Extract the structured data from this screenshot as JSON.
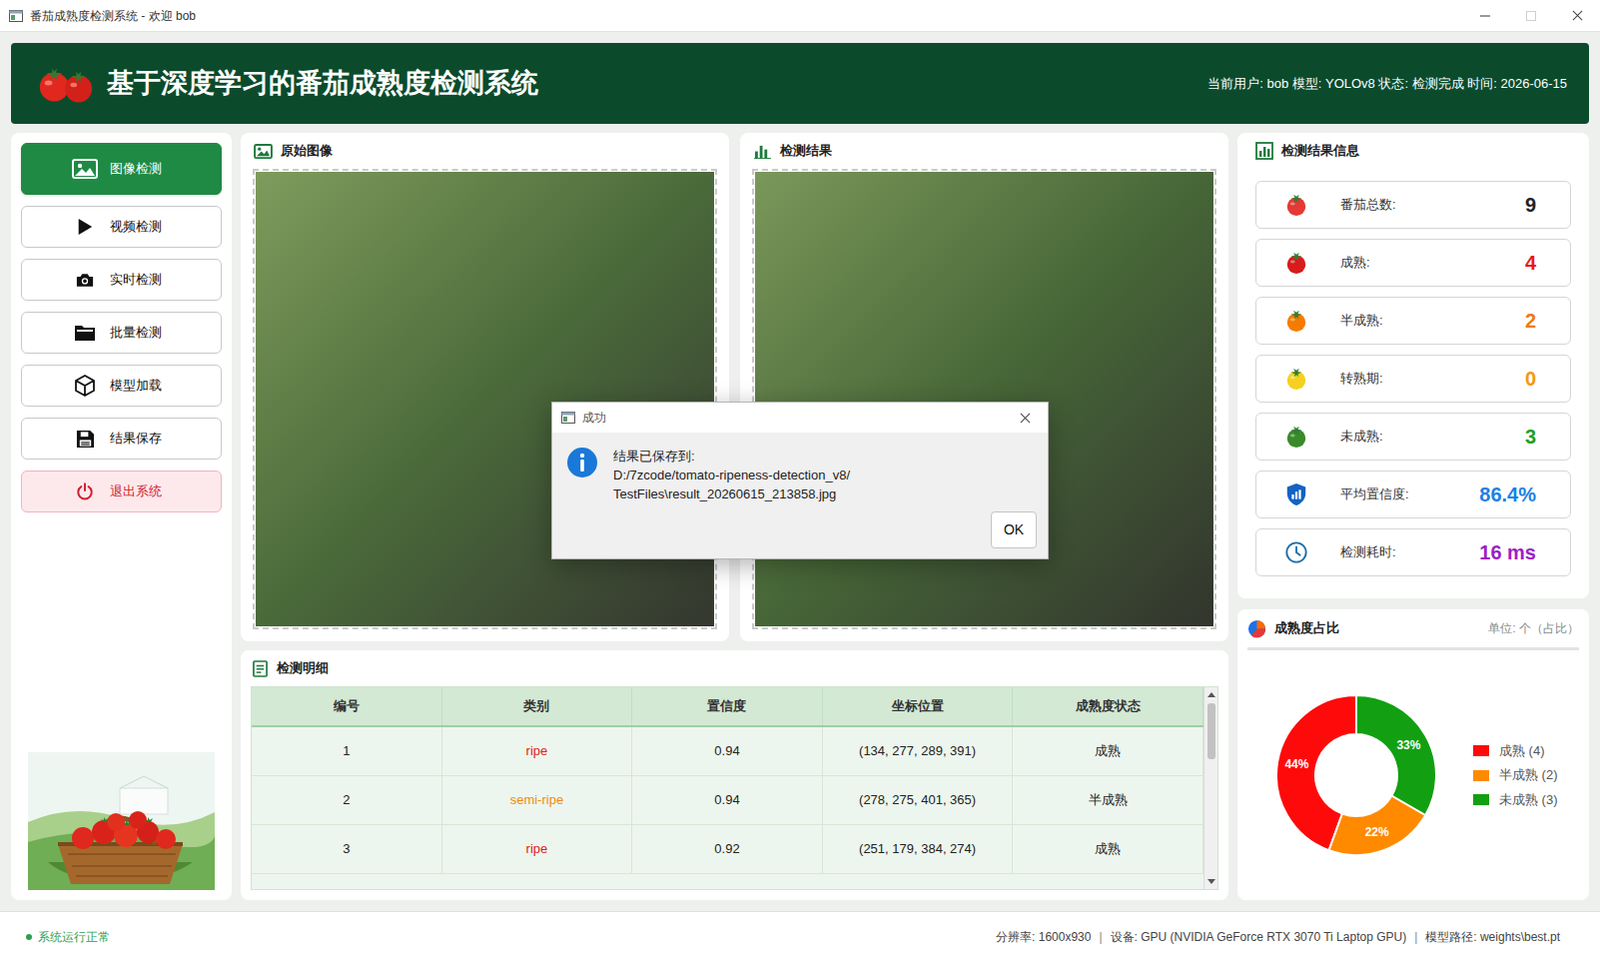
{
  "window": {
    "title": "番茄成熟度检测系统 - 欢迎 bob",
    "maximize_disabled": true
  },
  "header": {
    "title": "基于深度学习的番茄成熟度检测系统",
    "info": "当前用户: bob 模型: YOLOv8 状态: 检测完成 时间: 2026-06-15"
  },
  "sidebar": {
    "items": [
      {
        "label": "图像检测",
        "selected": true,
        "kind": "nav"
      },
      {
        "label": "视频检测",
        "selected": false,
        "kind": "nav"
      },
      {
        "label": "实时检测",
        "selected": false,
        "kind": "nav"
      },
      {
        "label": "批量检测",
        "selected": false,
        "kind": "nav"
      },
      {
        "label": "模型加载",
        "selected": false,
        "kind": "nav"
      },
      {
        "label": "结果保存",
        "selected": false,
        "kind": "nav"
      },
      {
        "label": "退出系统",
        "selected": false,
        "kind": "exit"
      }
    ]
  },
  "panels": {
    "original": "原始图像",
    "result": "检测结果"
  },
  "table": {
    "title": "检测明细",
    "columns": [
      "编号",
      "类别",
      "置信度",
      "坐标位置",
      "成熟度状态"
    ],
    "rows": [
      {
        "cells": [
          "1",
          "ripe",
          "0.94",
          "(134, 277, 289, 391)",
          "成熟"
        ],
        "color": "#e02020"
      },
      {
        "cells": [
          "2",
          "semi-ripe",
          "0.94",
          "(278, 275, 401, 365)",
          "半成熟"
        ],
        "color": "#f08a10"
      },
      {
        "cells": [
          "3",
          "ripe",
          "0.92",
          "(251, 179, 384, 274)",
          "成熟"
        ],
        "color": "#e02020"
      }
    ]
  },
  "stats": {
    "title": "检测结果信息",
    "items": [
      {
        "label": "番茄总数:",
        "value": "9",
        "color": "#222222"
      },
      {
        "label": "成熟:",
        "value": "4",
        "color": "#e81818"
      },
      {
        "label": "半成熟:",
        "value": "2",
        "color": "#f07a12"
      },
      {
        "label": "转熟期:",
        "value": "0",
        "color": "#f39a0a"
      },
      {
        "label": "未成熟:",
        "value": "3",
        "color": "#22a022"
      },
      {
        "label": "平均置信度:",
        "value": "86.4%",
        "color": "#1a80e6"
      },
      {
        "label": "检测耗时:",
        "value": "16 ms",
        "color": "#9c1fc4"
      }
    ]
  },
  "chart": {
    "title": "成熟度占比",
    "unit": "单位: 个（占比）",
    "series": [
      {
        "value": 4,
        "label": "44%",
        "legend": "成熟 (4)",
        "color": "#ff0a0a"
      },
      {
        "value": 2,
        "label": "22%",
        "legend": "半成熟 (2)",
        "color": "#ff8a00"
      },
      {
        "value": 3,
        "label": "33%",
        "legend": "未成熟 (3)",
        "color": "#12a012"
      }
    ]
  },
  "dialog": {
    "title": "成功",
    "lines": [
      "结果已保存到:",
      "D:/7zcode/tomato-ripeness-detection_v8/",
      "TestFiles\\result_20260615_213858.jpg"
    ],
    "button": "OK"
  },
  "status_bar": {
    "status": "系统运行正常",
    "separator": "|",
    "items": [
      "分辨率: 1600x930",
      "设备: GPU (NVIDIA GeForce RTX 3070 Ti Laptop GPU)",
      "模型路径: weights\\best.pt"
    ]
  }
}
